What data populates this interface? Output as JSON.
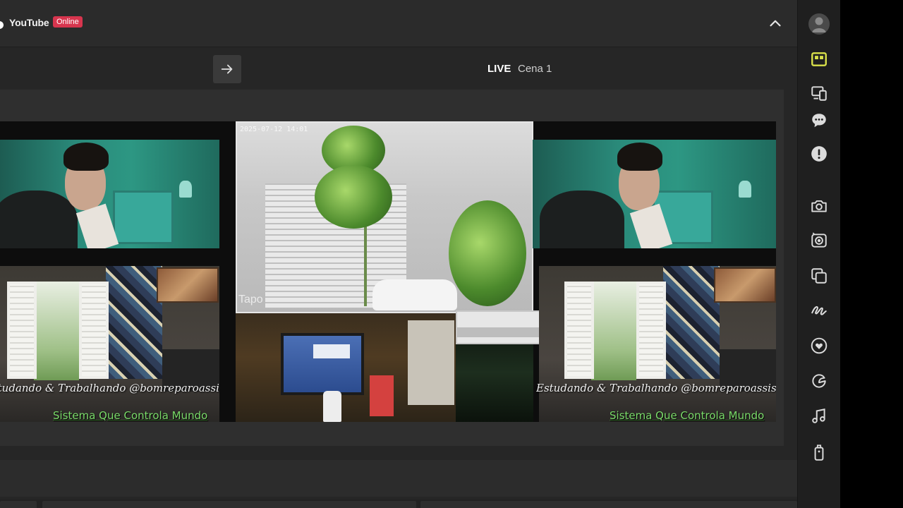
{
  "header": {
    "platform": "YouTube",
    "status_badge": "Online"
  },
  "scene": {
    "live_label": "LIVE",
    "scene_name": "Cena 1"
  },
  "overlay": {
    "caption_script": "Estudando & Trabalhando @bomreparoassistencia",
    "caption_green": "Sistema Que Controla Mundo"
  },
  "camera_feed": {
    "timestamp": "2025-07-12  14:01",
    "logo": "Tapo"
  },
  "icons": {
    "collapse": "chevron-up-icon",
    "transition": "arrow-right-icon",
    "sidebar": [
      "user-avatar-icon",
      "scenes-layout-icon",
      "devices-icon",
      "chat-icon",
      "alert-icon",
      "camera-icon",
      "record-camera-icon",
      "layers-icon",
      "draw-icon",
      "heart-badge-icon",
      "sticker-icon",
      "music-icon",
      "remote-icon"
    ]
  },
  "colors": {
    "badge": "#d7354e",
    "active_sidebar": "#d9e14a",
    "caption_green": "#7bdc6a"
  }
}
